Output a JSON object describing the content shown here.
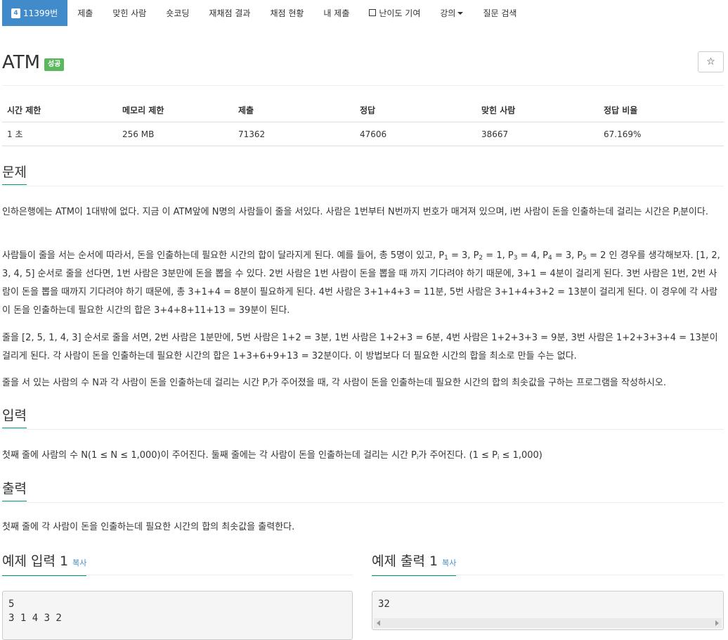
{
  "nav": {
    "problem_number": "11399번",
    "level": "4",
    "items": [
      "제출",
      "맞힌 사람",
      "숏코딩",
      "재채점 결과",
      "채점 현황",
      "내 제출",
      "난이도 기여",
      "강의",
      "질문 검색"
    ]
  },
  "problem": {
    "title": "ATM",
    "status_label": "성공",
    "star_icon": "☆"
  },
  "info": {
    "headers": [
      "시간 제한",
      "메모리 제한",
      "제출",
      "정답",
      "맞힌 사람",
      "정답 비율"
    ],
    "values": [
      "1 초",
      "256 MB",
      "71362",
      "47606",
      "38667",
      "67.169%"
    ]
  },
  "sections": {
    "description": "문제",
    "input": "입력",
    "output": "출력"
  },
  "description": {
    "p1_a": "인하은행에는 ATM이 1대밖에 없다. 지금 이 ATM앞에 N명의 사람들이 줄을 서있다. 사람은 1번부터 N번까지 번호가 매겨져 있으며, i번 사람이 돈을 인출하는데 걸리는 시간은 P",
    "p1_sub": "i",
    "p1_b": "분이다.",
    "p2_a": "사람들이 줄을 서는 순서에 따라서, 돈을 인출하는데 필요한 시간의 합이 달라지게 된다. 예를 들어, 총 5명이 있고, P",
    "p2_b": " = 3, P",
    "p2_c": " = 1, P",
    "p2_d": " = 4, P",
    "p2_e": " = 3, P",
    "p2_f": " = 2 인 경우를 생각해보자. [1, 2, 3, 4, 5] 순서로 줄을 선다면, 1번 사람은 3분만에 돈을 뽑을 수 있다. 2번 사람은 1번 사람이 돈을 뽑을 때 까지 기다려야 하기 때문에, 3+1 = 4분이 걸리게 된다. 3번 사람은 1번, 2번 사람이 돈을 뽑을 때까지 기다려야 하기 때문에, 총 3+1+4 = 8분이 필요하게 된다. 4번 사람은 3+1+4+3 = 11분, 5번 사람은 3+1+4+3+2 = 13분이 걸리게 된다. 이 경우에 각 사람이 돈을 인출하는데 필요한 시간의 합은 3+4+8+11+13 = 39분이 된다.",
    "sub1": "1",
    "sub2": "2",
    "sub3": "3",
    "sub4": "4",
    "sub5": "5",
    "p3": "줄을 [2, 5, 1, 4, 3] 순서로 줄을 서면, 2번 사람은 1분만에, 5번 사람은 1+2 = 3분, 1번 사람은 1+2+3 = 6분, 4번 사람은 1+2+3+3 = 9분, 3번 사람은 1+2+3+3+4 = 13분이 걸리게 된다. 각 사람이 돈을 인출하는데 필요한 시간의 합은 1+3+6+9+13 = 32분이다. 이 방법보다 더 필요한 시간의 합을 최소로 만들 수는 없다.",
    "p4_a": "줄을 서 있는 사람의 수 N과 각 사람이 돈을 인출하는데 걸리는 시간 P",
    "p4_sub": "i",
    "p4_b": "가 주어졌을 때, 각 사람이 돈을 인출하는데 필요한 시간의 합의 최솟값을 구하는 프로그램을 작성하시오."
  },
  "input_text": {
    "a": "첫째 줄에 사람의 수 N(1 ≤ N ≤ 1,000)이 주어진다. 둘째 줄에는 각 사람이 돈을 인출하는데 걸리는 시간 P",
    "sub1": "i",
    "b": "가 주어진다. (1 ≤ P",
    "sub2": "i",
    "c": " ≤ 1,000)"
  },
  "output_text": "첫째 줄에 각 사람이 돈을 인출하는데 필요한 시간의 합의 최솟값을 출력한다.",
  "samples": {
    "input_title": "예제 입력 1",
    "output_title": "예제 출력 1",
    "copy_label": "복사",
    "input_value": "5\n3 1 4 3 2",
    "output_value": "32"
  }
}
